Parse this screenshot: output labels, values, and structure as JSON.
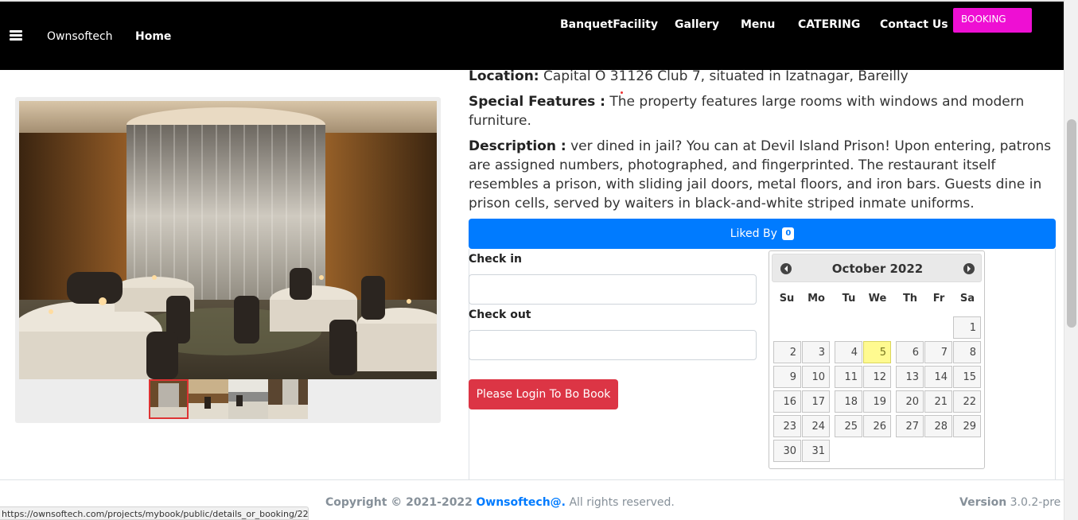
{
  "navbar": {
    "brand": "Ownsoftech",
    "home": "Home",
    "links": [
      "BanquetFacility",
      "Gallery",
      "Menu",
      "CATERING",
      "Contact Us"
    ],
    "booking": "BOOKING"
  },
  "details": {
    "location_label": "Location:",
    "location_value": "Capital O 31126 Club 7, situated in Izatnagar, Bareilly",
    "features_label": "Special Features :",
    "features_value": "The property features large rooms with windows and modern furniture.",
    "description_label": "Description :",
    "description_value": "ver dined in jail? You can at Devil Island Prison! Upon entering, patrons are assigned numbers, photographed, and fingerprinted. The restaurant itself resembles a prison, with sliding jail doors, metal floors, and iron bars. Guests dine in prison cells, served by waiters in black-and-white striped inmate uniforms."
  },
  "liked": {
    "label": "Liked By",
    "count": "0"
  },
  "form": {
    "checkin_label": "Check in",
    "checkout_label": "Check out",
    "login_button": "Please Login To Bo Book"
  },
  "calendar": {
    "title": "October 2022",
    "weekdays": [
      "Su",
      "Mo",
      "Tu",
      "We",
      "Th",
      "Fr",
      "Sa"
    ],
    "first_weekday_index": 6,
    "days_in_month": 31,
    "today": 5
  },
  "footer": {
    "copyright_prefix": "Copyright © 2021-2022",
    "brand": "Ownsoftech@.",
    "rights": "All rights reserved.",
    "version_label": "Version",
    "version_value": "3.0.2-pre"
  },
  "status_url": "https://ownsoftech.com/projects/mybook/public/details_or_booking/22#"
}
